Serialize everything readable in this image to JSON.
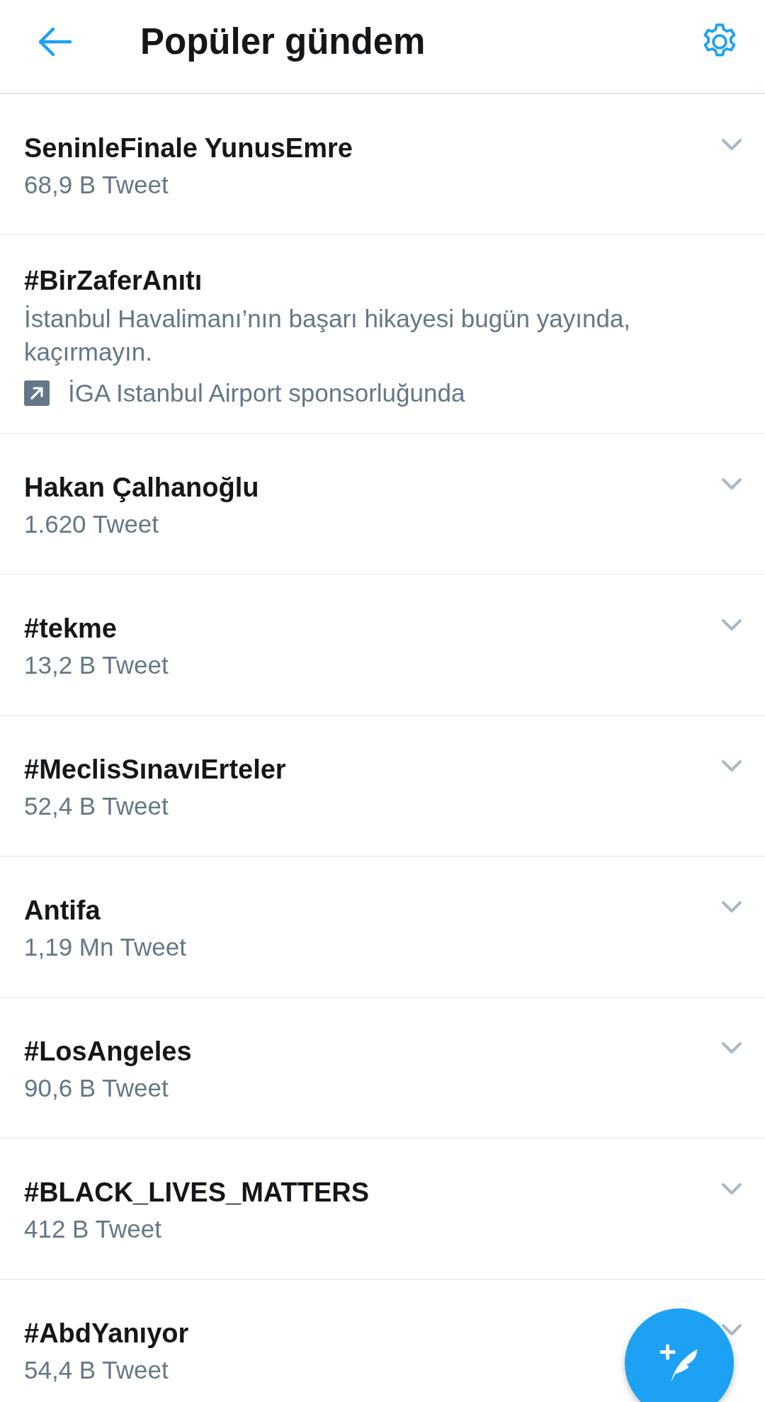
{
  "header": {
    "title": "Popüler gündem"
  },
  "trends": [
    {
      "kind": "trend",
      "name": "SeninleFinale YunusEmre",
      "count": "68,9 B Tweet"
    },
    {
      "kind": "promoted",
      "name": "#BirZaferAnıtı",
      "description": "İstanbul Havalimanı’nın başarı hikayesi bugün yayında, kaçırmayın.",
      "sponsor": "İGA Istanbul Airport sponsorluğunda"
    },
    {
      "kind": "trend",
      "name": "Hakan Çalhanoğlu",
      "count": "1.620 Tweet"
    },
    {
      "kind": "trend",
      "name": "#tekme",
      "count": "13,2 B Tweet"
    },
    {
      "kind": "trend",
      "name": "#MeclisSınavıErteler",
      "count": "52,4 B Tweet"
    },
    {
      "kind": "trend",
      "name": "Antifa",
      "count": "1,19 Mn Tweet"
    },
    {
      "kind": "trend",
      "name": "#LosAngeles",
      "count": "90,6 B Tweet"
    },
    {
      "kind": "trend",
      "name": "#BLACK_LIVES_MATTERS",
      "count": "412 B Tweet"
    },
    {
      "kind": "trend",
      "name": "#AbdYanıyor",
      "count": "54,4 B Tweet"
    }
  ]
}
